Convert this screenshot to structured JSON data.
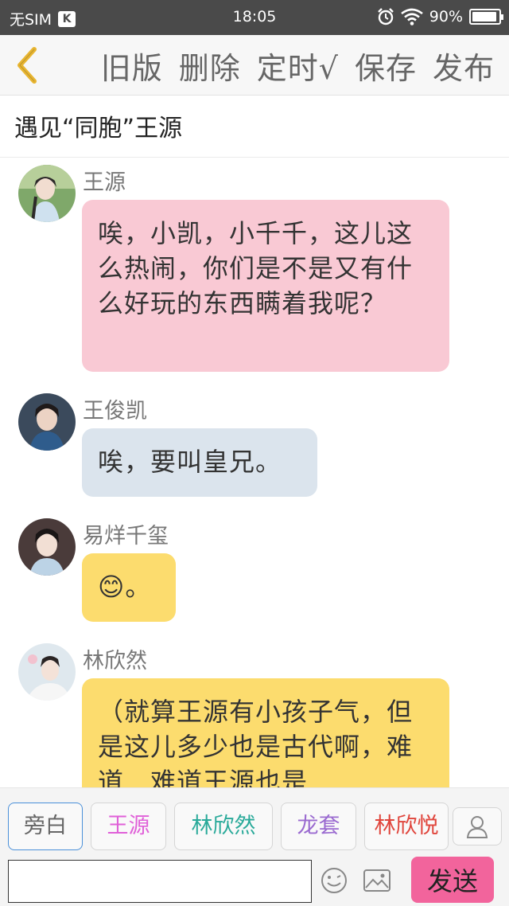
{
  "status_bar": {
    "carrier": "无SIM",
    "carrier_badge": "K",
    "time": "18:05",
    "battery": "90%",
    "battery_level": 0.9
  },
  "toolbar": {
    "old_version": "旧版",
    "delete": "删除",
    "schedule": "定时√",
    "save": "保存",
    "publish": "发布"
  },
  "story_title": "遇见“同胞”王源",
  "messages": [
    {
      "sender": "王源",
      "text": "唉，小凯，小千千，这儿这么热闹，你们是不是又有什么好玩的东西瞒着我呢？"
    },
    {
      "sender": "王俊凯",
      "text": "唉，要叫皇兄。"
    },
    {
      "sender": "易烊千玺",
      "text": "😊。"
    },
    {
      "sender": "林欣然",
      "text": "（就算王源有小孩子气，但是这儿多少也是古代啊，难道…难道王源也是"
    }
  ],
  "roles": [
    {
      "label": "旁白",
      "color": "#666666"
    },
    {
      "label": "王源",
      "color": "#e060d8"
    },
    {
      "label": "林欣然",
      "color": "#2aaa9a"
    },
    {
      "label": "龙套",
      "color": "#9a6ad0"
    },
    {
      "label": "林欣悦",
      "color": "#e0453c"
    }
  ],
  "input": {
    "placeholder": "",
    "value": ""
  },
  "send_label": "发送",
  "colors": {
    "send": "#f2649c",
    "back_arrow": "#e8b530"
  }
}
